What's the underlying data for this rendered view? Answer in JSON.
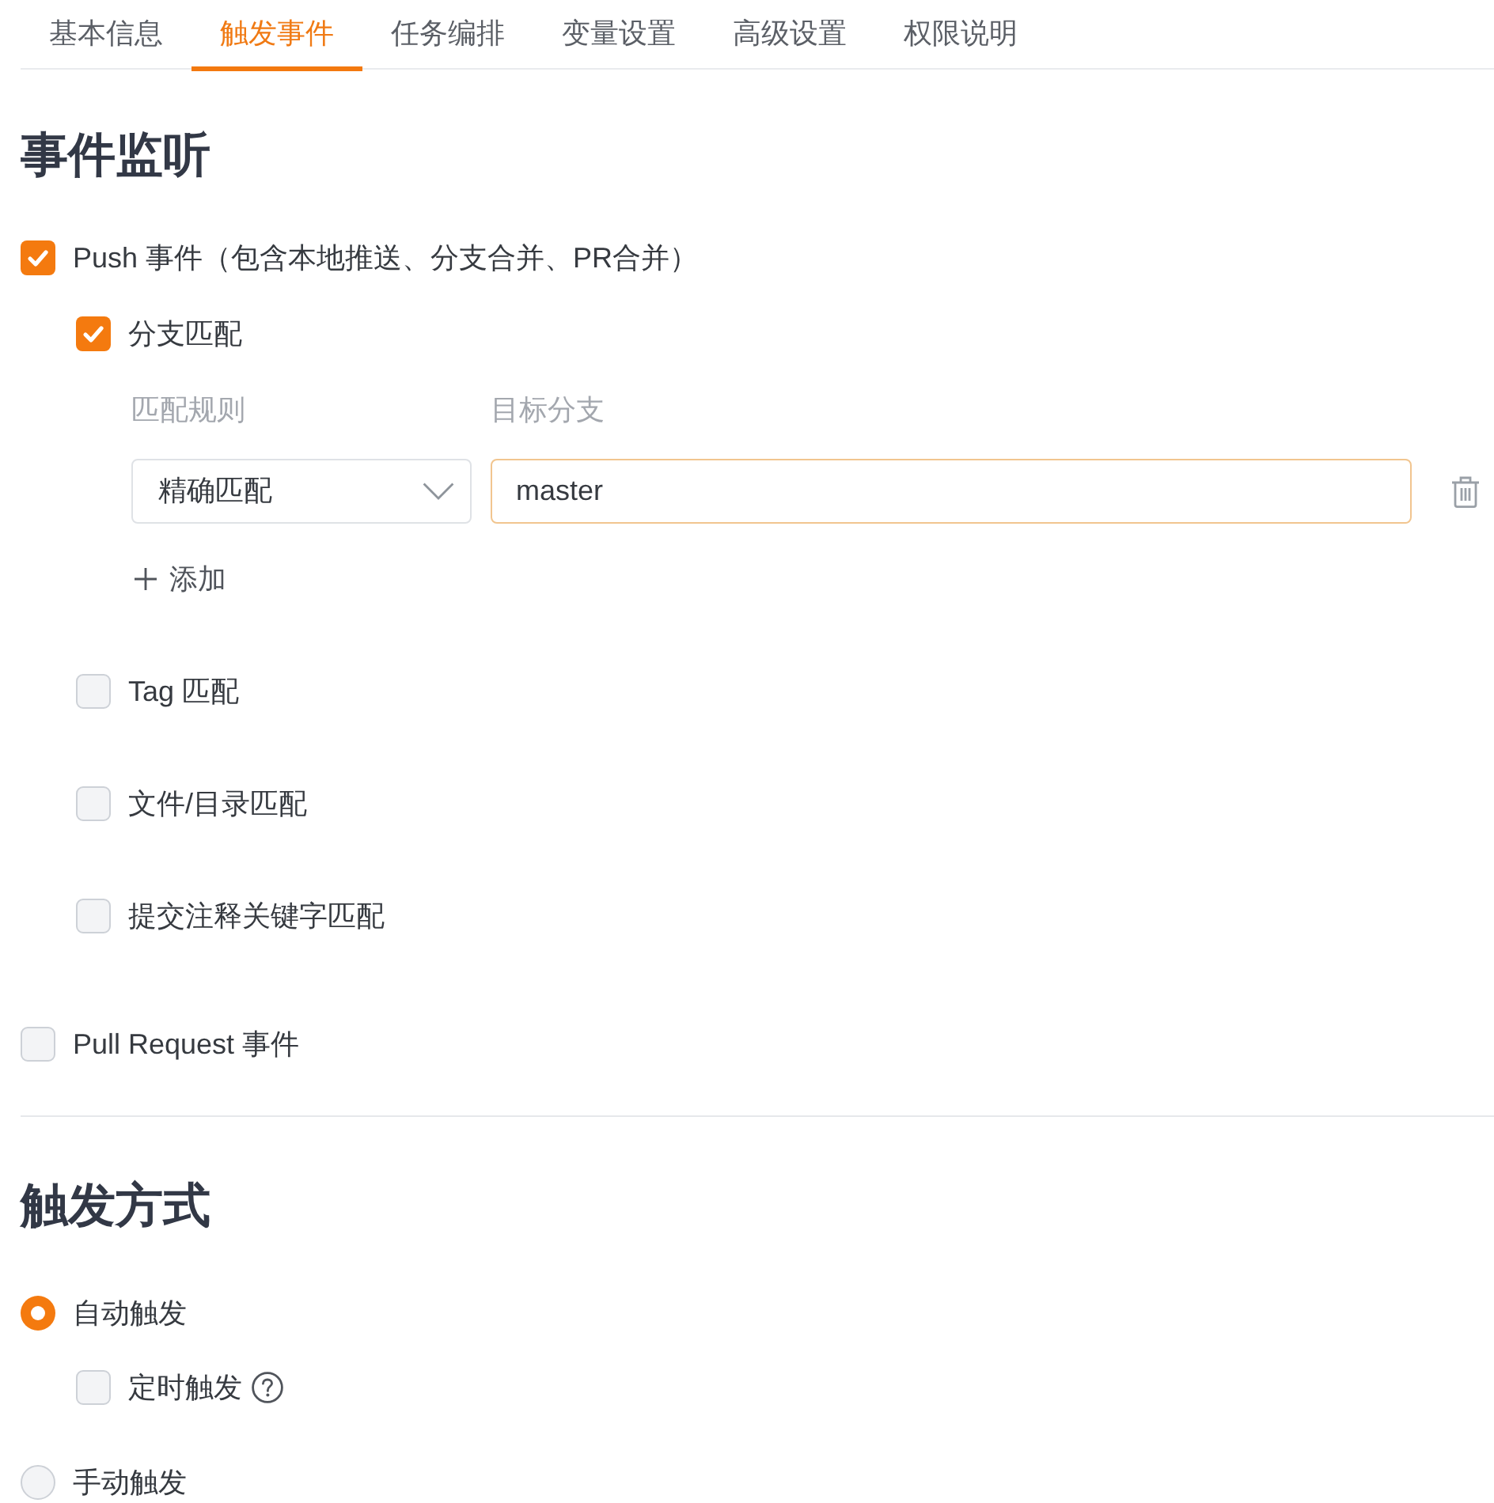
{
  "tabs": [
    {
      "label": "基本信息",
      "selected": false
    },
    {
      "label": "触发事件",
      "selected": true
    },
    {
      "label": "任务编排",
      "selected": false
    },
    {
      "label": "变量设置",
      "selected": false
    },
    {
      "label": "高级设置",
      "selected": false
    },
    {
      "label": "权限说明",
      "selected": false
    }
  ],
  "event_section": {
    "title": "事件监听",
    "events": [
      {
        "label": "Push 事件（包含本地推送、分支合并、PR合并）",
        "checked": true,
        "children": [
          {
            "label": "分支匹配",
            "checked": true,
            "rules": {
              "columns": [
                "匹配规则",
                "目标分支"
              ],
              "rows": [
                {
                  "match_type": "精确匹配",
                  "branch": "master"
                }
              ],
              "add_label": "添加"
            }
          },
          {
            "label": "Tag 匹配",
            "checked": false
          },
          {
            "label": "文件/目录匹配",
            "checked": false
          },
          {
            "label": "提交注释关键字匹配",
            "checked": false
          }
        ]
      },
      {
        "label": "Pull Request 事件",
        "checked": false
      }
    ]
  },
  "trigger_section": {
    "title": "触发方式",
    "modes": [
      {
        "label": "自动触发",
        "selected": true,
        "children": [
          {
            "label": "定时触发",
            "checked": false,
            "help": true
          }
        ]
      },
      {
        "label": "手动触发",
        "selected": false
      }
    ]
  }
}
